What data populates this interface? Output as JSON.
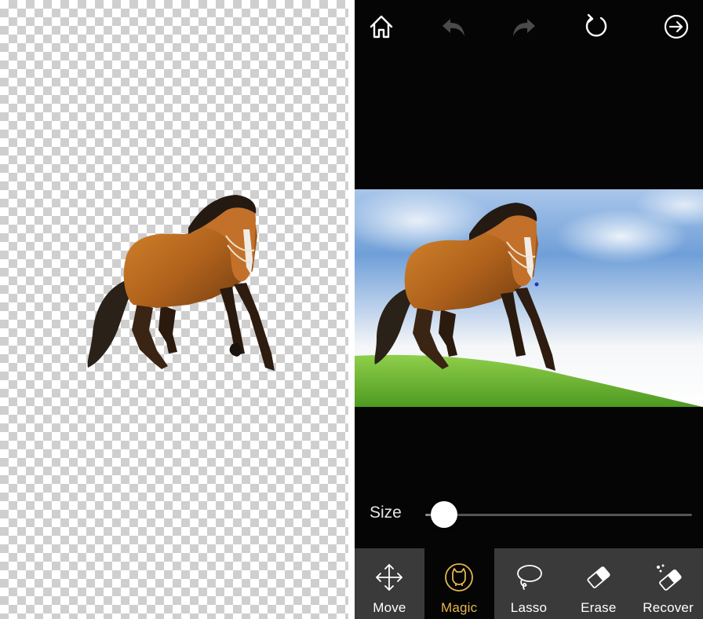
{
  "colors": {
    "editor_background": "#050505",
    "toolbar_background": "#3a3a3a",
    "active_tool": "#e5b64a",
    "icon_default": "#ffffff",
    "icon_disabled": "#4a4a4a"
  },
  "top_bar": {
    "home": {
      "icon": "house-icon",
      "enabled": true
    },
    "undo": {
      "icon": "undo-arrow-icon",
      "enabled": false
    },
    "redo": {
      "icon": "redo-arrow-icon",
      "enabled": false
    },
    "reset": {
      "icon": "circular-arrow-icon",
      "enabled": true
    },
    "next": {
      "icon": "circle-arrow-right-icon",
      "enabled": true
    }
  },
  "brush_size": {
    "label": "Size",
    "value_fraction": 0.07
  },
  "toolbar": {
    "active": "magic",
    "tools": [
      {
        "id": "move",
        "label": "Move",
        "icon": "four-way-arrow-icon"
      },
      {
        "id": "magic",
        "label": "Magic",
        "icon": "magic-cat-icon"
      },
      {
        "id": "lasso",
        "label": "Lasso",
        "icon": "lasso-icon"
      },
      {
        "id": "erase",
        "label": "Erase",
        "icon": "eraser-icon"
      },
      {
        "id": "recover",
        "label": "Recover",
        "icon": "eraser-sparkle-icon"
      }
    ]
  }
}
